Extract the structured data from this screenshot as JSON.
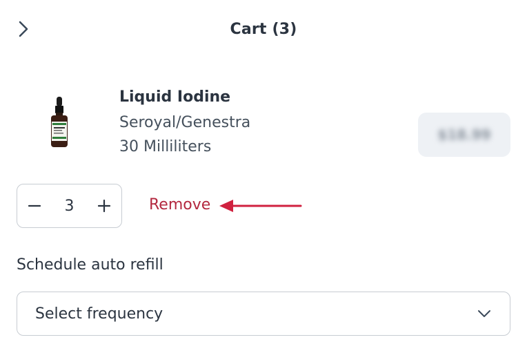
{
  "header": {
    "title": "Cart (3)",
    "back_icon": "chevron-right-icon"
  },
  "item": {
    "name": "Liquid Iodine",
    "brand": "Seroyal/Genestra",
    "size": "30 Milliliters",
    "price": "$18.99",
    "image_icon": "dropper-bottle-image"
  },
  "quantity": {
    "value": "3",
    "decrement_icon": "minus-icon",
    "increment_icon": "plus-icon"
  },
  "remove_label": "Remove",
  "annotation": {
    "arrow_color": "#d0213f"
  },
  "auto_refill": {
    "label": "Schedule auto refill",
    "select_value": "Select frequency",
    "dropdown_icon": "chevron-down-icon"
  },
  "colors": {
    "text": "#2b3440",
    "remove": "#b3283f",
    "border": "#c7ccd2",
    "price_bg": "#eef1f5"
  }
}
